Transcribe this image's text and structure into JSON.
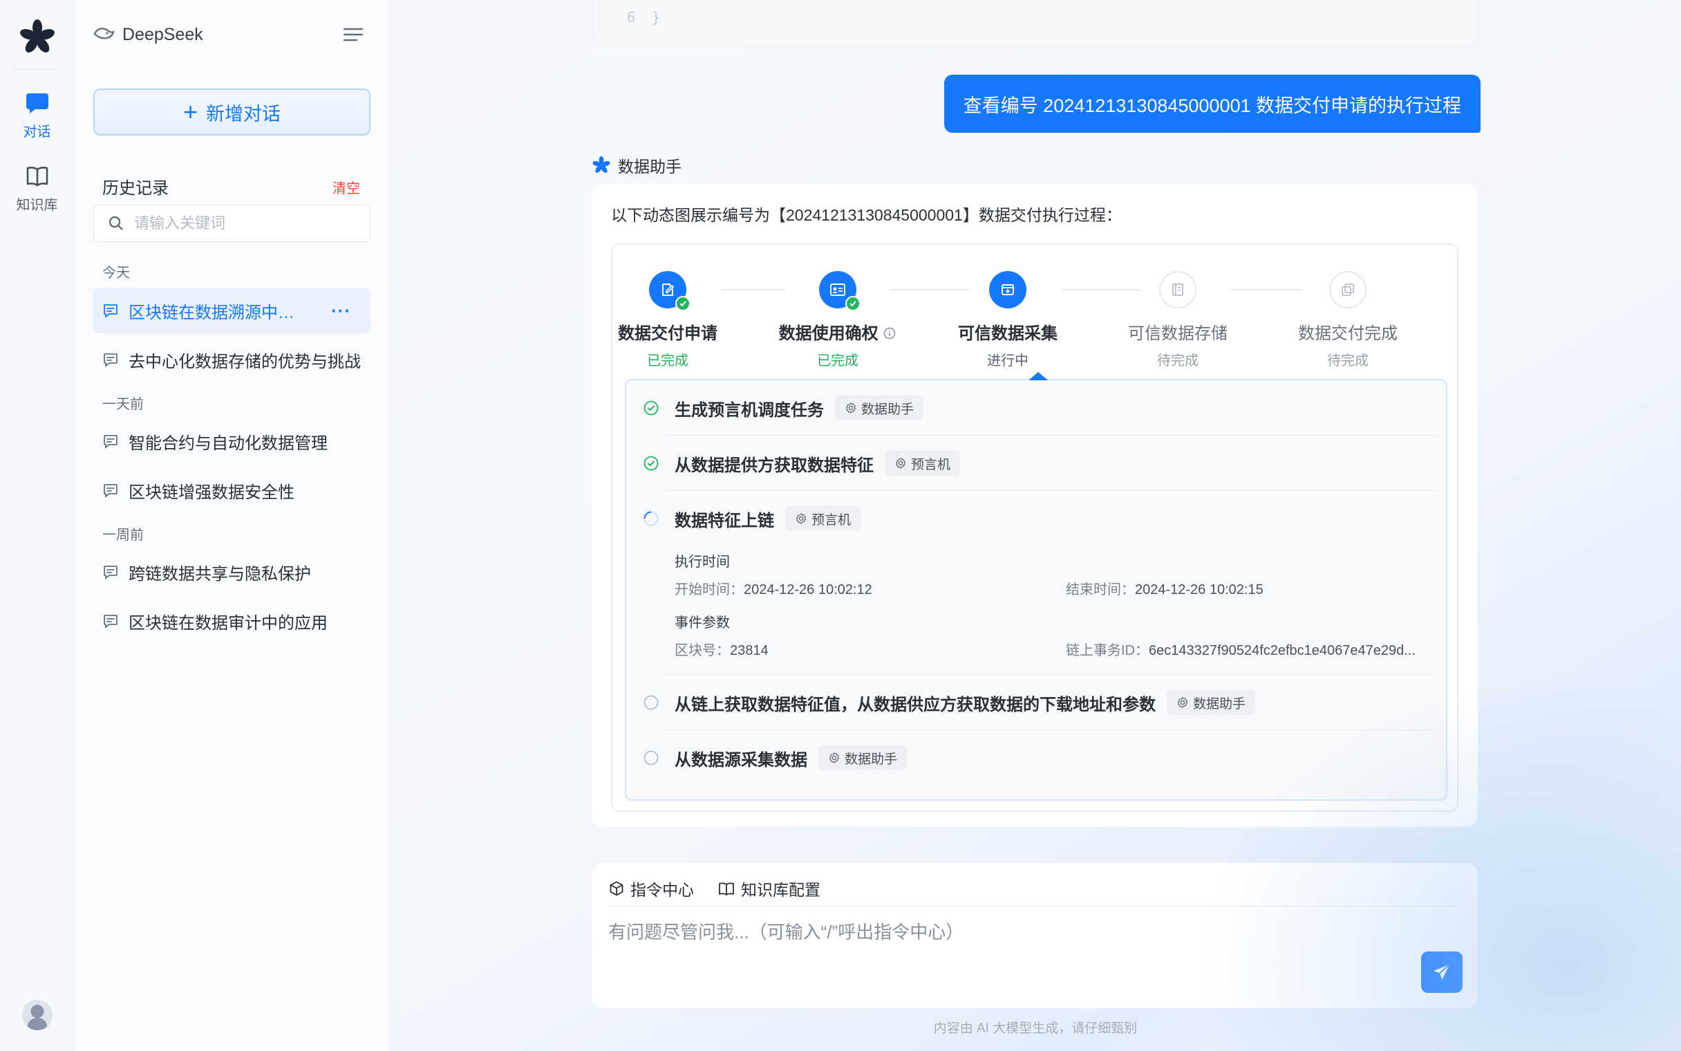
{
  "rail": {
    "chat_label": "对话",
    "kb_label": "知识库"
  },
  "sidebar": {
    "brand": "DeepSeek",
    "new_chat": "新增对话",
    "history_title": "历史记录",
    "clear": "清空",
    "search_placeholder": "请输入关键词",
    "groups": {
      "today": "今天",
      "one_day": "一天前",
      "one_week": "一周前"
    },
    "items": [
      {
        "label": "区块链在数据溯源中的应用"
      },
      {
        "label": "去中心化数据存储的优势与挑战"
      },
      {
        "label": "智能合约与自动化数据管理"
      },
      {
        "label": "区块链增强数据安全性"
      },
      {
        "label": "跨链数据共享与隐私保护"
      },
      {
        "label": "区块链在数据审计中的应用"
      }
    ],
    "more": "···"
  },
  "main": {
    "code_line": "6",
    "code_brace": "}",
    "user_message": "查看编号 20241213130845000001 数据交付申请的执行过程",
    "assistant_name": "数据助手",
    "intro": "以下动态图展示编号为【20241213130845000001】数据交付执行过程：",
    "steps": [
      {
        "name": "数据交付申请",
        "status": "已完成"
      },
      {
        "name": "数据使用确权",
        "status": "已完成"
      },
      {
        "name": "可信数据采集",
        "status": "进行中"
      },
      {
        "name": "可信数据存储",
        "status": "待完成"
      },
      {
        "name": "数据交付完成",
        "status": "待完成"
      }
    ],
    "tasks": [
      {
        "name": "生成预言机调度任务",
        "tag": "数据助手"
      },
      {
        "name": "从数据提供方获取数据特征",
        "tag": "预言机"
      },
      {
        "name": "数据特征上链",
        "tag": "预言机"
      },
      {
        "name": "从链上获取数据特征值，从数据供应方获取数据的下载地址和参数",
        "tag": "数据助手"
      },
      {
        "name": "从数据源采集数据",
        "tag": "数据助手"
      }
    ],
    "detail": {
      "exec_time_label": "执行时间",
      "start_label": "开始时间：",
      "start_value": "2024-12-26 10:02:12",
      "end_label": "结束时间：",
      "end_value": "2024-12-26 10:02:15",
      "params_label": "事件参数",
      "block_label": "区块号：",
      "block_value": "23814",
      "tx_label": "链上事务ID：",
      "tx_value": "6ec143327f90524fc2efbc1e4067e47e29d..."
    },
    "input": {
      "tool_commands": "指令中心",
      "tool_kb": "知识库配置",
      "placeholder": "有问题尽管问我...（可输入“/”呼出指令中心）"
    },
    "footer": "内容由 AI 大模型生成，请仔细甄别"
  },
  "colors": {
    "accent": "#1677ff",
    "success": "#23b45a",
    "danger": "#f5473a"
  }
}
